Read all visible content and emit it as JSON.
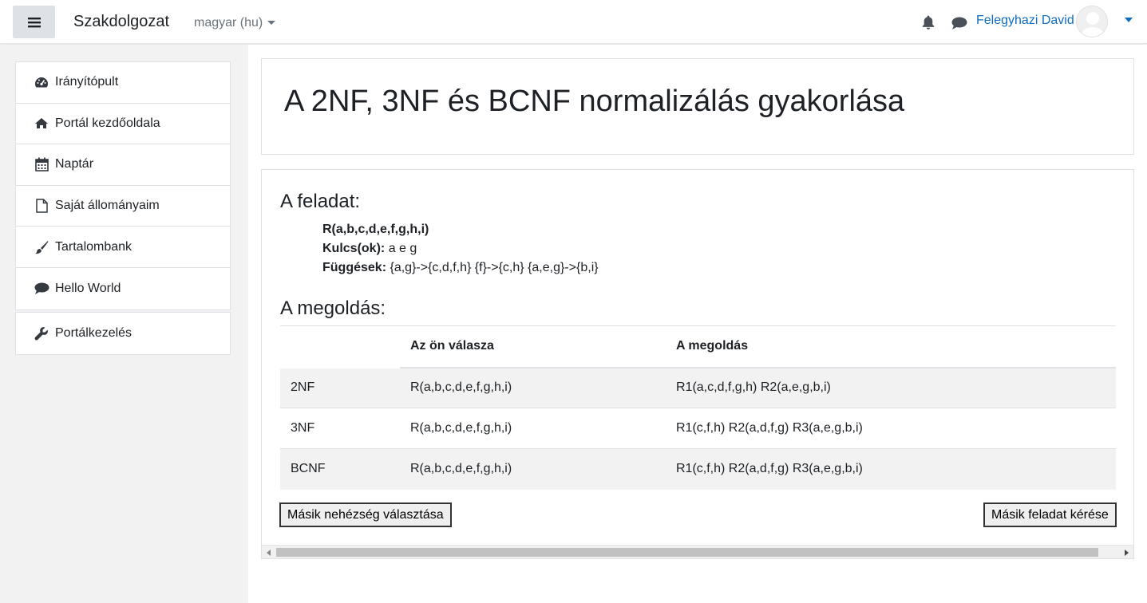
{
  "navbar": {
    "site_name": "Szakdolgozat",
    "language": "magyar (hu)",
    "user_name": "Felegyhazi David"
  },
  "sidebar": {
    "items": [
      {
        "label": "Irányítópult",
        "icon": "dashboard-icon"
      },
      {
        "label": "Portál kezdőoldala",
        "icon": "home-icon"
      },
      {
        "label": "Naptár",
        "icon": "calendar-icon"
      },
      {
        "label": "Saját állományaim",
        "icon": "file-icon"
      },
      {
        "label": "Tartalombank",
        "icon": "brush-icon"
      },
      {
        "label": "Hello World",
        "icon": "chat-icon"
      }
    ],
    "admin": {
      "label": "Portálkezelés",
      "icon": "wrench-icon"
    }
  },
  "page": {
    "title": "A 2NF, 3NF és BCNF normalizálás gyakorlása"
  },
  "task": {
    "heading": "A feladat:",
    "relation": "R(a,b,c,d,e,f,g,h,i)",
    "keys_label": "Kulcs(ok):",
    "keys_value": "a e g",
    "deps_label": "Függések:",
    "deps_value": "{a,g}->{c,d,f,h} {f}->{c,h} {a,e,g}->{b,i}"
  },
  "solution": {
    "heading": "A megoldás:",
    "columns": [
      "",
      "Az ön válasza",
      "A megoldás"
    ],
    "rows": [
      {
        "form": "2NF",
        "answer": "R(a,b,c,d,e,f,g,h,i)",
        "solution": "R1(a,c,d,f,g,h) R2(a,e,g,b,i)"
      },
      {
        "form": "3NF",
        "answer": "R(a,b,c,d,e,f,g,h,i)",
        "solution": "R1(c,f,h) R2(a,d,f,g) R3(a,e,g,b,i)"
      },
      {
        "form": "BCNF",
        "answer": "R(a,b,c,d,e,f,g,h,i)",
        "solution": "R1(c,f,h) R2(a,d,f,g) R3(a,e,g,b,i)"
      }
    ]
  },
  "buttons": {
    "other_difficulty": "Másik nehézség választása",
    "other_task": "Másik feladat kérése"
  },
  "colors": {
    "accent": "#0f6cbf",
    "sidebar_bg": "#f2f2f2",
    "border": "#dee2e6"
  }
}
